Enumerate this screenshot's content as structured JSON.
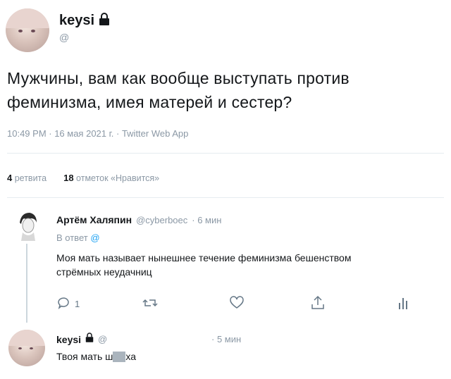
{
  "tweet": {
    "author_name": "keysi",
    "author_handle": "@",
    "text": "Мужчины, вам как вообще выступать против феминизма, имея матерей и сестер?",
    "timestamp": "10:49 PM · 16 мая 2021 г. · Twitter Web App",
    "retweets_count": "4",
    "retweets_label": "ретвита",
    "likes_count": "18",
    "likes_label": "отметок «Нравится»"
  },
  "reply1": {
    "author_name": "Артём Халяпин",
    "author_handle": "@cyberboec",
    "time": "· 6 мин",
    "reply_to_prefix": "В ответ",
    "reply_to_handle": "@",
    "text_line1": "Моя мать называет нынешнее течение феминизма бешенством",
    "text_line2": "стрёмных неудачниц",
    "reply_count": "1"
  },
  "reply2": {
    "author_name": "keysi",
    "author_handle": "@",
    "time": "· 5 мин",
    "text_before": "Твоя мать ш",
    "text_after": "ха"
  },
  "icons": [
    "lock-icon",
    "reply-icon",
    "retweet-icon",
    "like-icon",
    "share-icon",
    "analytics-icon"
  ]
}
